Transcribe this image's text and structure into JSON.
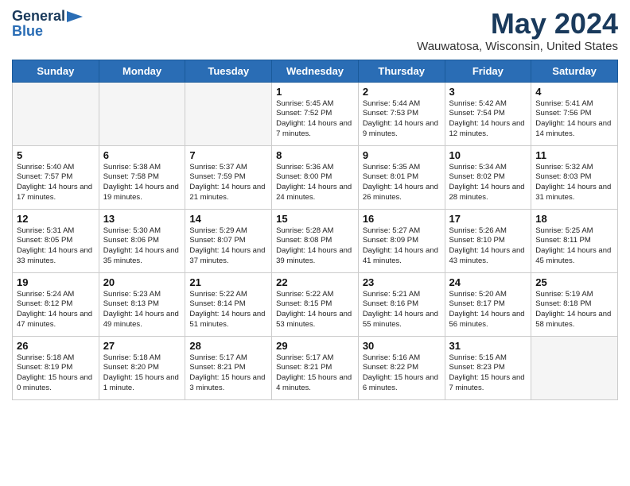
{
  "header": {
    "logo_general": "General",
    "logo_blue": "Blue",
    "month_title": "May 2024",
    "location": "Wauwatosa, Wisconsin, United States"
  },
  "days_of_week": [
    "Sunday",
    "Monday",
    "Tuesday",
    "Wednesday",
    "Thursday",
    "Friday",
    "Saturday"
  ],
  "weeks": [
    [
      {
        "date": "",
        "info": ""
      },
      {
        "date": "",
        "info": ""
      },
      {
        "date": "",
        "info": ""
      },
      {
        "date": "1",
        "info": "Sunrise: 5:45 AM\nSunset: 7:52 PM\nDaylight: 14 hours\nand 7 minutes."
      },
      {
        "date": "2",
        "info": "Sunrise: 5:44 AM\nSunset: 7:53 PM\nDaylight: 14 hours\nand 9 minutes."
      },
      {
        "date": "3",
        "info": "Sunrise: 5:42 AM\nSunset: 7:54 PM\nDaylight: 14 hours\nand 12 minutes."
      },
      {
        "date": "4",
        "info": "Sunrise: 5:41 AM\nSunset: 7:56 PM\nDaylight: 14 hours\nand 14 minutes."
      }
    ],
    [
      {
        "date": "5",
        "info": "Sunrise: 5:40 AM\nSunset: 7:57 PM\nDaylight: 14 hours\nand 17 minutes."
      },
      {
        "date": "6",
        "info": "Sunrise: 5:38 AM\nSunset: 7:58 PM\nDaylight: 14 hours\nand 19 minutes."
      },
      {
        "date": "7",
        "info": "Sunrise: 5:37 AM\nSunset: 7:59 PM\nDaylight: 14 hours\nand 21 minutes."
      },
      {
        "date": "8",
        "info": "Sunrise: 5:36 AM\nSunset: 8:00 PM\nDaylight: 14 hours\nand 24 minutes."
      },
      {
        "date": "9",
        "info": "Sunrise: 5:35 AM\nSunset: 8:01 PM\nDaylight: 14 hours\nand 26 minutes."
      },
      {
        "date": "10",
        "info": "Sunrise: 5:34 AM\nSunset: 8:02 PM\nDaylight: 14 hours\nand 28 minutes."
      },
      {
        "date": "11",
        "info": "Sunrise: 5:32 AM\nSunset: 8:03 PM\nDaylight: 14 hours\nand 31 minutes."
      }
    ],
    [
      {
        "date": "12",
        "info": "Sunrise: 5:31 AM\nSunset: 8:05 PM\nDaylight: 14 hours\nand 33 minutes."
      },
      {
        "date": "13",
        "info": "Sunrise: 5:30 AM\nSunset: 8:06 PM\nDaylight: 14 hours\nand 35 minutes."
      },
      {
        "date": "14",
        "info": "Sunrise: 5:29 AM\nSunset: 8:07 PM\nDaylight: 14 hours\nand 37 minutes."
      },
      {
        "date": "15",
        "info": "Sunrise: 5:28 AM\nSunset: 8:08 PM\nDaylight: 14 hours\nand 39 minutes."
      },
      {
        "date": "16",
        "info": "Sunrise: 5:27 AM\nSunset: 8:09 PM\nDaylight: 14 hours\nand 41 minutes."
      },
      {
        "date": "17",
        "info": "Sunrise: 5:26 AM\nSunset: 8:10 PM\nDaylight: 14 hours\nand 43 minutes."
      },
      {
        "date": "18",
        "info": "Sunrise: 5:25 AM\nSunset: 8:11 PM\nDaylight: 14 hours\nand 45 minutes."
      }
    ],
    [
      {
        "date": "19",
        "info": "Sunrise: 5:24 AM\nSunset: 8:12 PM\nDaylight: 14 hours\nand 47 minutes."
      },
      {
        "date": "20",
        "info": "Sunrise: 5:23 AM\nSunset: 8:13 PM\nDaylight: 14 hours\nand 49 minutes."
      },
      {
        "date": "21",
        "info": "Sunrise: 5:22 AM\nSunset: 8:14 PM\nDaylight: 14 hours\nand 51 minutes."
      },
      {
        "date": "22",
        "info": "Sunrise: 5:22 AM\nSunset: 8:15 PM\nDaylight: 14 hours\nand 53 minutes."
      },
      {
        "date": "23",
        "info": "Sunrise: 5:21 AM\nSunset: 8:16 PM\nDaylight: 14 hours\nand 55 minutes."
      },
      {
        "date": "24",
        "info": "Sunrise: 5:20 AM\nSunset: 8:17 PM\nDaylight: 14 hours\nand 56 minutes."
      },
      {
        "date": "25",
        "info": "Sunrise: 5:19 AM\nSunset: 8:18 PM\nDaylight: 14 hours\nand 58 minutes."
      }
    ],
    [
      {
        "date": "26",
        "info": "Sunrise: 5:18 AM\nSunset: 8:19 PM\nDaylight: 15 hours\nand 0 minutes."
      },
      {
        "date": "27",
        "info": "Sunrise: 5:18 AM\nSunset: 8:20 PM\nDaylight: 15 hours\nand 1 minute."
      },
      {
        "date": "28",
        "info": "Sunrise: 5:17 AM\nSunset: 8:21 PM\nDaylight: 15 hours\nand 3 minutes."
      },
      {
        "date": "29",
        "info": "Sunrise: 5:17 AM\nSunset: 8:21 PM\nDaylight: 15 hours\nand 4 minutes."
      },
      {
        "date": "30",
        "info": "Sunrise: 5:16 AM\nSunset: 8:22 PM\nDaylight: 15 hours\nand 6 minutes."
      },
      {
        "date": "31",
        "info": "Sunrise: 5:15 AM\nSunset: 8:23 PM\nDaylight: 15 hours\nand 7 minutes."
      },
      {
        "date": "",
        "info": ""
      }
    ]
  ]
}
